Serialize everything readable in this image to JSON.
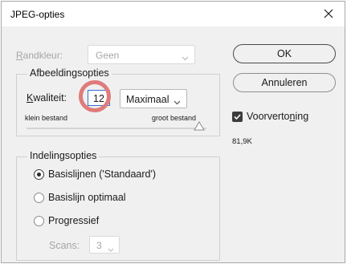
{
  "window": {
    "title": "JPEG-opties"
  },
  "matte": {
    "label_first": "R",
    "label_rest": "andkleur:",
    "value": "Geen"
  },
  "image_options": {
    "legend": "Afbeeldingsopties",
    "quality_label_first": "K",
    "quality_label_rest": "waliteit:",
    "quality_value": "12",
    "quality_preset": "Maximaal",
    "slider_min_label": "klein bestand",
    "slider_max_label": "groot bestand",
    "slider_level_fraction": 1.0
  },
  "format_options": {
    "legend": "Indelingsopties",
    "radios": [
      {
        "label": "Basislijnen ('Standaard')",
        "checked": true
      },
      {
        "label": "Basislijn optimaal",
        "checked": false
      },
      {
        "label": "Progressief",
        "checked": false
      }
    ],
    "scans_label": "Scans:",
    "scans_value": "3"
  },
  "buttons": {
    "ok": "OK",
    "cancel": "Annuleren"
  },
  "preview": {
    "label_prefix": "Voorverto",
    "label_underlined": "n",
    "label_suffix": "ing",
    "checked": true,
    "file_size": "81,9K"
  },
  "colors": {
    "accent_ring": "#e07b7b",
    "focus_border": "#2f6fd0"
  }
}
